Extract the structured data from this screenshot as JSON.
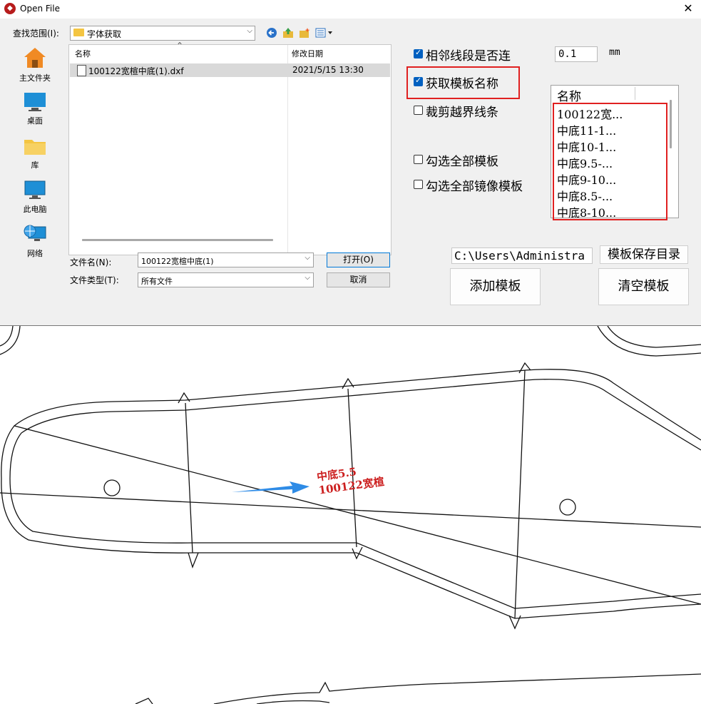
{
  "window": {
    "title": "Open File",
    "close_glyph": "✕",
    "app_icon": "app-logo-icon"
  },
  "dialog": {
    "look_in_label": "查找范围(I):",
    "look_in_value": "字体获取",
    "places": [
      {
        "label": "主文件夹",
        "icon": "home-icon"
      },
      {
        "label": "桌面",
        "icon": "desktop-icon"
      },
      {
        "label": "库",
        "icon": "library-folder-icon"
      },
      {
        "label": "此电脑",
        "icon": "computer-icon"
      },
      {
        "label": "网络",
        "icon": "network-icon"
      }
    ],
    "columns": {
      "name": "名称",
      "modified": "修改日期"
    },
    "files": [
      {
        "name": "100122宽楦中底(1).dxf",
        "modified": "2021/5/15 13:30"
      }
    ],
    "filename_label": "文件名(N):",
    "filename_value": "100122宽楦中底(1)",
    "filetype_label": "文件类型(T):",
    "filetype_value": "所有文件",
    "open_button": "打开(O)",
    "cancel_button": "取消"
  },
  "options": {
    "adjacent_connected": {
      "label": "相邻线段是否连",
      "checked": true
    },
    "tolerance": {
      "value": "0.1",
      "unit": "mm"
    },
    "get_template_name": {
      "label": "获取模板名称",
      "checked": true
    },
    "clip_out_of_bounds": {
      "label": "裁剪越界线条",
      "checked": false
    },
    "select_all_templates": {
      "label": "勾选全部模板",
      "checked": false
    },
    "select_all_mirror_templates": {
      "label": "勾选全部镜像模板",
      "checked": false
    }
  },
  "template_list": {
    "header": "名称",
    "items": [
      "100122宽...",
      "中底11-1...",
      "中底10-1...",
      "中底9.5-...",
      "中底9-10...",
      "中底8.5-...",
      "中底8-10..."
    ]
  },
  "save_dir": {
    "path": "C:\\Users\\Administra",
    "button": "模板保存目录"
  },
  "actions": {
    "add_template": "添加模板",
    "clear_templates": "清空模板"
  },
  "canvas": {
    "label_line1": "中底5.5",
    "label_line2": "100122宽楦",
    "label_color": "#cc1f1f",
    "arrow_color": "#2e8be6"
  },
  "colors": {
    "highlight_red": "#e02020",
    "checkbox_blue": "#0060c0",
    "dialog_bg": "#f0f0f0"
  }
}
